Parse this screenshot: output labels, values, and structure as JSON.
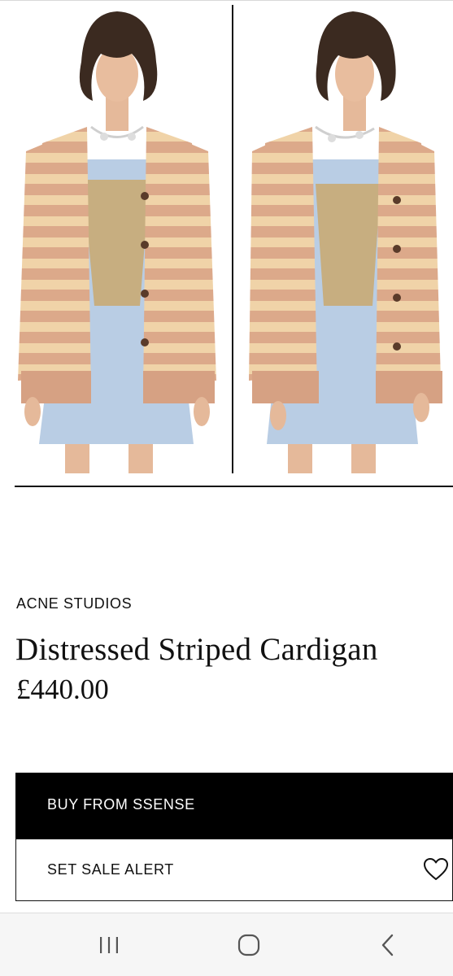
{
  "gallery": {
    "images": [
      {
        "alt": "model-front-view"
      },
      {
        "alt": "model-three-quarter-view"
      }
    ]
  },
  "product": {
    "brand": "ACNE STUDIOS",
    "title": "Distressed Striped Cardigan",
    "price": "£440.00"
  },
  "actions": {
    "buy_label": "BUY FROM SSENSE",
    "alert_label": "SET SALE ALERT"
  },
  "icons": {
    "wishlist": "heart-icon",
    "recents": "recent-apps-icon",
    "home": "home-icon",
    "back": "back-icon"
  },
  "colors": {
    "cardigan_base": "#dca98a",
    "cardigan_stripe": "#f0d3a8",
    "dress": "#b9cde4",
    "buy_button": "#000000"
  }
}
